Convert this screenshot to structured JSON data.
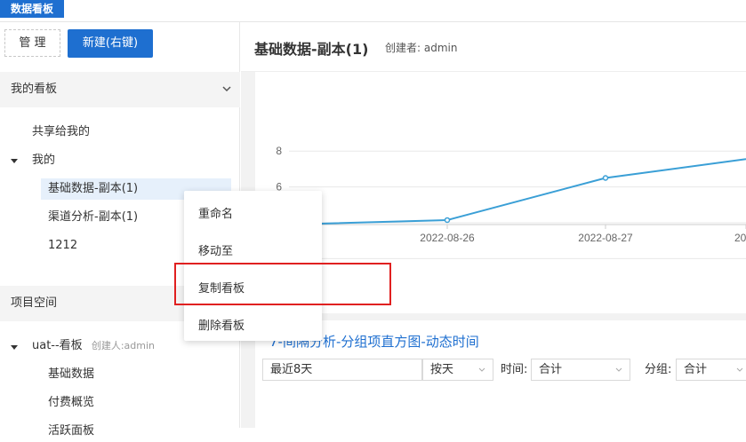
{
  "app": {
    "tab_label": "数据看板"
  },
  "sidebar": {
    "manage_label": "管 理",
    "new_label": "新建(右键)",
    "my_boards": {
      "header": "我的看板",
      "shared": "共享给我的",
      "mine": "我的",
      "items": [
        "基础数据-副本(1)",
        "渠道分析-副本(1)",
        "1212"
      ]
    },
    "project_space": {
      "header": "项目空间",
      "group_label": "uat--看板",
      "group_creator": "创建人:admin",
      "items": [
        "基础数据",
        "付费概览",
        "活跃面板"
      ]
    }
  },
  "main": {
    "title": "基础数据-副本(1)",
    "creator": "创建者: admin"
  },
  "chart_data": {
    "type": "line",
    "x": [
      "",
      "2022-08-26",
      "2022-08-27",
      "20"
    ],
    "values": [
      3.9,
      4.15,
      6.5,
      7.55
    ],
    "ylim": [
      0,
      8
    ],
    "yticks": [
      2,
      4,
      6,
      8
    ],
    "grid": true,
    "color": "#3a9fd6"
  },
  "card2": {
    "title": "7-间隔分析-分组项直方图-动态时间",
    "filters": {
      "range": "最近8天",
      "granularity": "按天",
      "time_label": "时间:",
      "time_value": "合计",
      "group_label": "分组:",
      "group_value": "合计"
    }
  },
  "context_menu": {
    "items": [
      "重命名",
      "移动至",
      "复制看板",
      "删除看板"
    ]
  },
  "colors": {
    "primary": "#1e6fd0",
    "highlight": "#e02020"
  }
}
